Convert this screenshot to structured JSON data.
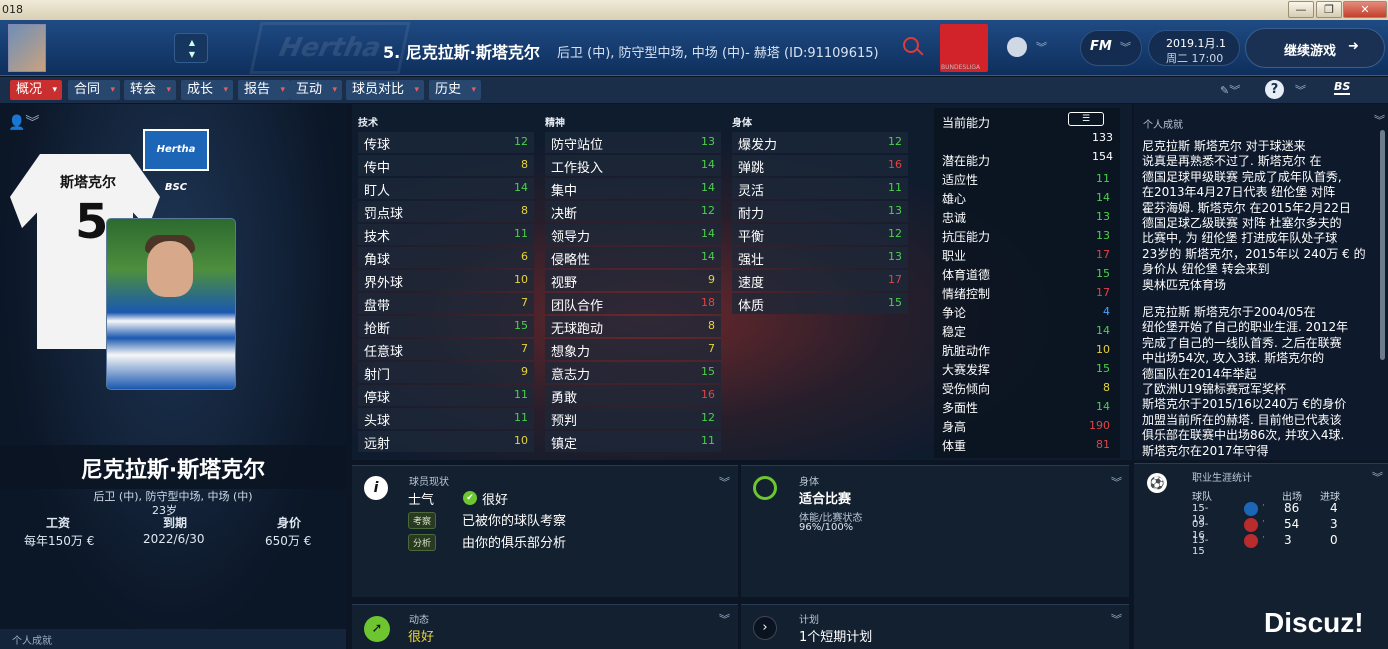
{
  "window": {
    "title": "018",
    "min": "—",
    "max": "❐",
    "close": "✕"
  },
  "header": {
    "player_title": "5. 尼克拉斯·斯塔克尔",
    "player_positions": "后卫 (中), 防守型中场, 中场 (中)- 赫塔 (ID:91109615)",
    "watermark": "Hertha BSC",
    "league_badge": "BUNDESLIGA",
    "fm_label": "FM",
    "date_line1": "2019.1月.1",
    "date_line2": "周二 17:00",
    "continue_label": "继续游戏",
    "icons": [
      "search-icon",
      "globe-icon",
      "chevron-down-icon",
      "continue-arrow-icon"
    ]
  },
  "tabs": [
    {
      "label": "概况",
      "active": true
    },
    {
      "label": "合同",
      "active": false
    },
    {
      "label": "转会",
      "active": false
    },
    {
      "label": "成长",
      "active": false
    },
    {
      "label": "报告",
      "active": false
    },
    {
      "label": "互动",
      "active": false
    },
    {
      "label": "球员对比",
      "active": false
    },
    {
      "label": "历史",
      "active": false
    }
  ],
  "toolbar_right": {
    "bs": "BS",
    "help": "?"
  },
  "left": {
    "shirt_name": "斯塔克尔",
    "shirt_number": "5",
    "flag_text": "Hertha BSC",
    "big_name": "尼克拉斯·斯塔克尔",
    "sub_positions": "后卫 (中), 防守型中场, 中场 (中)",
    "age": "23岁",
    "wage_label": "工资",
    "wage_value": "每年150万 €",
    "expiry_label": "到期",
    "expiry_value": "2022/6/30",
    "value_label": "身价",
    "value_value": "650万 €",
    "bottom_label": "个人成就"
  },
  "columns": {
    "technical": "技术",
    "mental": "精神",
    "physical": "身体"
  },
  "technical": [
    {
      "label": "传球",
      "value": "12",
      "color": "#4cd04c"
    },
    {
      "label": "传中",
      "value": "8",
      "color": "#e7d33a"
    },
    {
      "label": "盯人",
      "value": "14",
      "color": "#4cd04c"
    },
    {
      "label": "罚点球",
      "value": "8",
      "color": "#e7d33a"
    },
    {
      "label": "技术",
      "value": "11",
      "color": "#4cd04c"
    },
    {
      "label": "角球",
      "value": "6",
      "color": "#e7d33a"
    },
    {
      "label": "界外球",
      "value": "10",
      "color": "#e7d33a"
    },
    {
      "label": "盘带",
      "value": "7",
      "color": "#e7d33a"
    },
    {
      "label": "抢断",
      "value": "15",
      "color": "#4cd04c"
    },
    {
      "label": "任意球",
      "value": "7",
      "color": "#e7d33a"
    },
    {
      "label": "射门",
      "value": "9",
      "color": "#e7d33a"
    },
    {
      "label": "停球",
      "value": "11",
      "color": "#4cd04c"
    },
    {
      "label": "头球",
      "value": "11",
      "color": "#4cd04c"
    },
    {
      "label": "远射",
      "value": "10",
      "color": "#e7d33a"
    }
  ],
  "mental": [
    {
      "label": "防守站位",
      "value": "13",
      "color": "#4cd04c"
    },
    {
      "label": "工作投入",
      "value": "14",
      "color": "#4cd04c"
    },
    {
      "label": "集中",
      "value": "14",
      "color": "#4cd04c"
    },
    {
      "label": "决断",
      "value": "12",
      "color": "#4cd04c"
    },
    {
      "label": "领导力",
      "value": "14",
      "color": "#4cd04c"
    },
    {
      "label": "侵略性",
      "value": "14",
      "color": "#4cd04c"
    },
    {
      "label": "视野",
      "value": "9",
      "color": "#e7d33a"
    },
    {
      "label": "团队合作",
      "value": "18",
      "color": "#e04545"
    },
    {
      "label": "无球跑动",
      "value": "8",
      "color": "#e7d33a"
    },
    {
      "label": "想象力",
      "value": "7",
      "color": "#e7d33a"
    },
    {
      "label": "意志力",
      "value": "15",
      "color": "#4cd04c"
    },
    {
      "label": "勇敢",
      "value": "16",
      "color": "#e04545"
    },
    {
      "label": "预判",
      "value": "12",
      "color": "#4cd04c"
    },
    {
      "label": "镇定",
      "value": "11",
      "color": "#4cd04c"
    }
  ],
  "physical": [
    {
      "label": "爆发力",
      "value": "12",
      "color": "#4cd04c"
    },
    {
      "label": "弹跳",
      "value": "16",
      "color": "#e04545"
    },
    {
      "label": "灵活",
      "value": "11",
      "color": "#4cd04c"
    },
    {
      "label": "耐力",
      "value": "13",
      "color": "#4cd04c"
    },
    {
      "label": "平衡",
      "value": "12",
      "color": "#4cd04c"
    },
    {
      "label": "强壮",
      "value": "13",
      "color": "#4cd04c"
    },
    {
      "label": "速度",
      "value": "17",
      "color": "#e04545"
    },
    {
      "label": "体质",
      "value": "15",
      "color": "#4cd04c"
    }
  ],
  "summary": {
    "ca_label": "当前能力",
    "ca_value": "133",
    "pa_label": "潜在能力",
    "pa_value": "154",
    "rows": [
      {
        "label": "适应性",
        "value": "11",
        "color": "#4cd04c"
      },
      {
        "label": "雄心",
        "value": "14",
        "color": "#4cd04c"
      },
      {
        "label": "忠诚",
        "value": "13",
        "color": "#4cd04c"
      },
      {
        "label": "抗压能力",
        "value": "13",
        "color": "#4cd04c"
      },
      {
        "label": "职业",
        "value": "17",
        "color": "#e04545"
      },
      {
        "label": "体育道德",
        "value": "15",
        "color": "#4cd04c"
      },
      {
        "label": "情绪控制",
        "value": "17",
        "color": "#e04545"
      },
      {
        "label": "争论",
        "value": "4",
        "color": "#4aa0ff"
      },
      {
        "label": "稳定",
        "value": "14",
        "color": "#4cd04c"
      },
      {
        "label": "肮脏动作",
        "value": "10",
        "color": "#e7d33a"
      },
      {
        "label": "大赛发挥",
        "value": "15",
        "color": "#4cd04c"
      },
      {
        "label": "受伤倾向",
        "value": "8",
        "color": "#e7d33a"
      },
      {
        "label": "多面性",
        "value": "14",
        "color": "#4cd04c"
      },
      {
        "label": "身高",
        "value": "190",
        "color": "#e04545"
      },
      {
        "label": "体重",
        "value": "81",
        "color": "#e04545"
      }
    ]
  },
  "bio": {
    "title": "个人成就",
    "para1": [
      "尼克拉斯 斯塔克尔 对于球迷来",
      "说真是再熟悉不过了. 斯塔克尔 在",
      "德国足球甲级联赛 完成了成年队首秀,",
      "在2013年4月27日代表 纽伦堡 对阵",
      "霍芬海姆. 斯塔克尔 在2015年2月22日",
      "德国足球乙级联赛 对阵 杜塞尔多夫的",
      "比赛中, 为 纽伦堡 打进成年队处子球",
      "23岁的 斯塔克尔，2015年以 240万 € 的",
      "身价从 纽伦堡 转会来到",
      "奥林匹克体育场"
    ],
    "para2": [
      "尼克拉斯 斯塔克尔于2004/05在",
      "纽伦堡开始了自己的职业生涯. 2012年",
      "完成了自己的一线队首秀. 之后在联赛",
      "中出场54次, 攻入3球. 斯塔克尔的",
      "德国队在2014年举起",
      "了欧洲U19锦标赛冠军奖杯",
      "斯塔克尔于2015/16以240万 €的身价",
      "加盟当前所在的赫塔. 目前他已代表该",
      "俱乐部在联赛中出场86次, 并攻入4球.",
      "斯塔克尔在2017年守得"
    ]
  },
  "cards": {
    "status": {
      "header": "球员现状",
      "morale_label": "士气",
      "morale_value": "很好",
      "badge1": "考察",
      "text1": "已被你的球队考察",
      "badge2": "分析",
      "text2": "由你的俱乐部分析"
    },
    "physical": {
      "header": "身体",
      "value": "适合比赛",
      "sub_label": "体能/比赛状态",
      "sub_value": "96%/100%"
    },
    "form": {
      "header": "动态",
      "value": "很好"
    },
    "plan": {
      "header": "计划",
      "value": "1个短期计划"
    }
  },
  "career": {
    "header": "职业生涯统计",
    "col_team": "球队",
    "col_apps": "出场",
    "col_goals": "进球",
    "rows": [
      {
        "season": "15-19",
        "apps": "86",
        "goals": "4",
        "club_color": "#1d66b7"
      },
      {
        "season": "09-16",
        "apps": "54",
        "goals": "3",
        "club_color": "#b82c2c"
      },
      {
        "season": "13-15",
        "apps": "3",
        "goals": "0",
        "club_color": "#b82c2c"
      }
    ]
  },
  "watermark_text": "Discuz!"
}
